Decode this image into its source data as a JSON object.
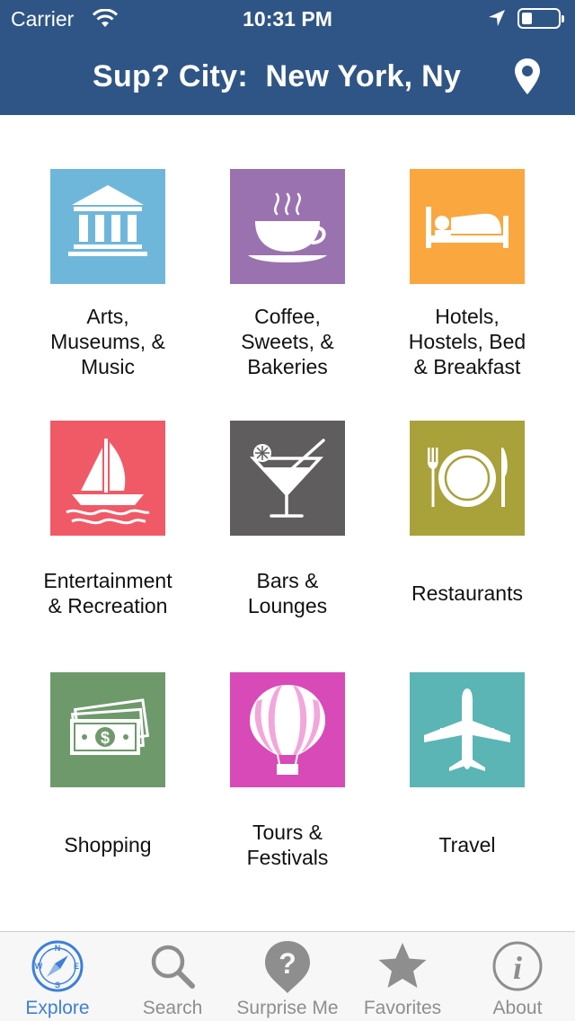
{
  "status_bar": {
    "carrier": "Carrier",
    "time": "10:31 PM"
  },
  "header": {
    "title": "Sup? City:  New York, Ny",
    "color": "#2f5586"
  },
  "categories": [
    {
      "label_lines": [
        "Arts,",
        "Museums, &",
        "Music"
      ],
      "color": "#6fb7da",
      "icon": "museum-icon"
    },
    {
      "label_lines": [
        "Coffee,",
        "Sweets, &",
        "Bakeries"
      ],
      "color": "#9b72b0",
      "icon": "coffee-cup-icon"
    },
    {
      "label_lines": [
        "Hotels,",
        "Hostels, Bed",
        "& Breakfast"
      ],
      "color": "#f9a73e",
      "icon": "bed-icon"
    },
    {
      "label_lines": [
        "Entertainment",
        "& Recreation"
      ],
      "color": "#f05a66",
      "icon": "sailboat-icon"
    },
    {
      "label_lines": [
        "Bars &",
        "Lounges"
      ],
      "color": "#5f5d5e",
      "icon": "cocktail-icon"
    },
    {
      "label_lines": [
        "Restaurants"
      ],
      "color": "#a9a13a",
      "icon": "plate-icon"
    },
    {
      "label_lines": [
        "Shopping"
      ],
      "color": "#6e9a6b",
      "icon": "money-icon"
    },
    {
      "label_lines": [
        "Tours &",
        "Festivals"
      ],
      "color": "#d84ab8",
      "icon": "hot-air-balloon-icon"
    },
    {
      "label_lines": [
        "Travel"
      ],
      "color": "#5bb5b5",
      "icon": "airplane-icon"
    }
  ],
  "tabs": [
    {
      "label": "Explore",
      "icon": "compass-icon",
      "active": true
    },
    {
      "label": "Search",
      "icon": "search-icon",
      "active": false
    },
    {
      "label": "Surprise Me",
      "icon": "question-icon",
      "active": false
    },
    {
      "label": "Favorites",
      "icon": "star-icon",
      "active": false
    },
    {
      "label": "About",
      "icon": "info-icon",
      "active": false
    }
  ],
  "colors": {
    "tab_active": "#3d7fd9",
    "tab_inactive": "#8e8e8e"
  }
}
